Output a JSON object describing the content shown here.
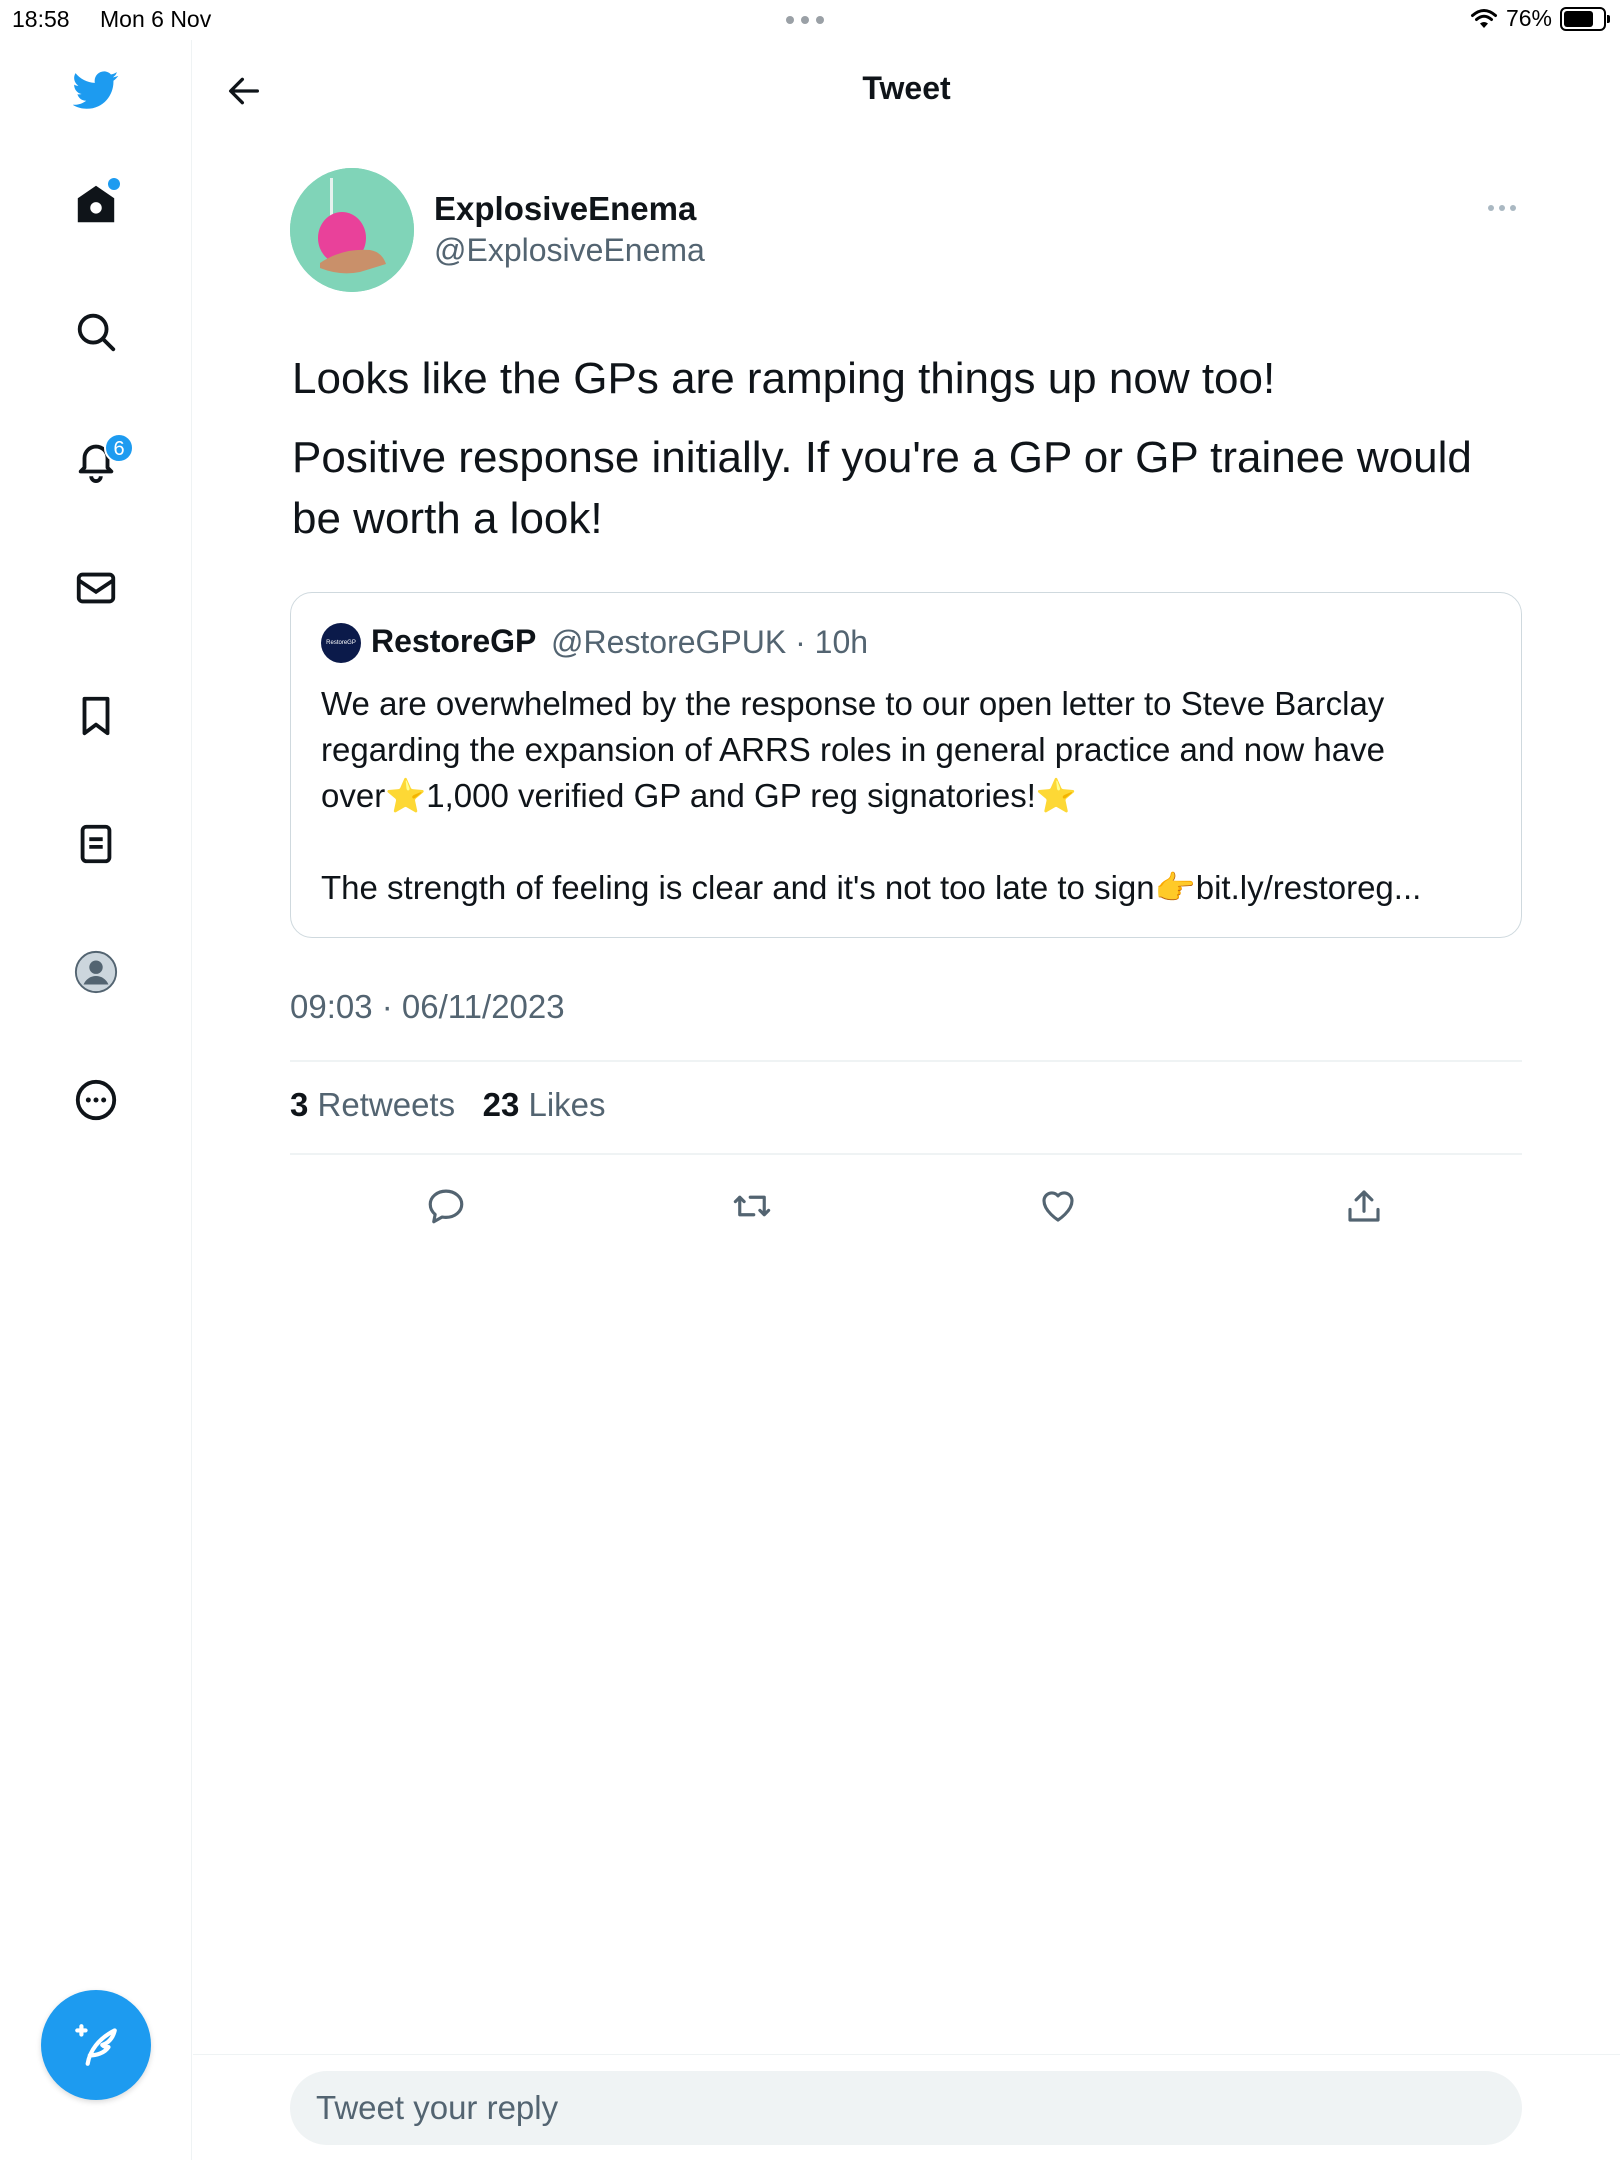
{
  "status_bar": {
    "time": "18:58",
    "date": "Mon 6 Nov",
    "battery": "76%",
    "battery_level": 0.76
  },
  "sidebar": {
    "notifications_badge": "6",
    "items": [
      "home-icon",
      "search-icon",
      "bell-icon",
      "mail-icon",
      "bookmark-icon",
      "lists-icon",
      "profile-icon",
      "more-circle-icon"
    ]
  },
  "header": {
    "title": "Tweet"
  },
  "tweet": {
    "author_name": "ExplosiveEnema",
    "author_handle": "@ExplosiveEnema",
    "text_lines": [
      "Looks like the GPs are ramping things up now too!",
      "Positive response initially. If you're a GP or GP trainee would be worth a look!"
    ],
    "quote": {
      "avatar_text": "RestoreGP",
      "name": "RestoreGP",
      "meta": "@RestoreGPUK · 10h",
      "paragraphs": [
        "We are overwhelmed by the response to our open letter to Steve Barclay regarding the expansion of ARRS roles in general practice and now have over⭐1,000 verified GP and GP reg signatories!⭐",
        "The strength of feeling is clear and it's not too late to sign👉bit.ly/restoreg..."
      ]
    },
    "timestamp": "09:03 · 06/11/2023",
    "retweets_count": "3",
    "retweets_label": "Retweets",
    "likes_count": "23",
    "likes_label": "Likes"
  },
  "reply": {
    "placeholder": "Tweet your reply"
  },
  "colors": {
    "accent": "#1d9bf0",
    "text": "#0f1419",
    "secondary": "#536471",
    "border": "#eff3f4"
  }
}
